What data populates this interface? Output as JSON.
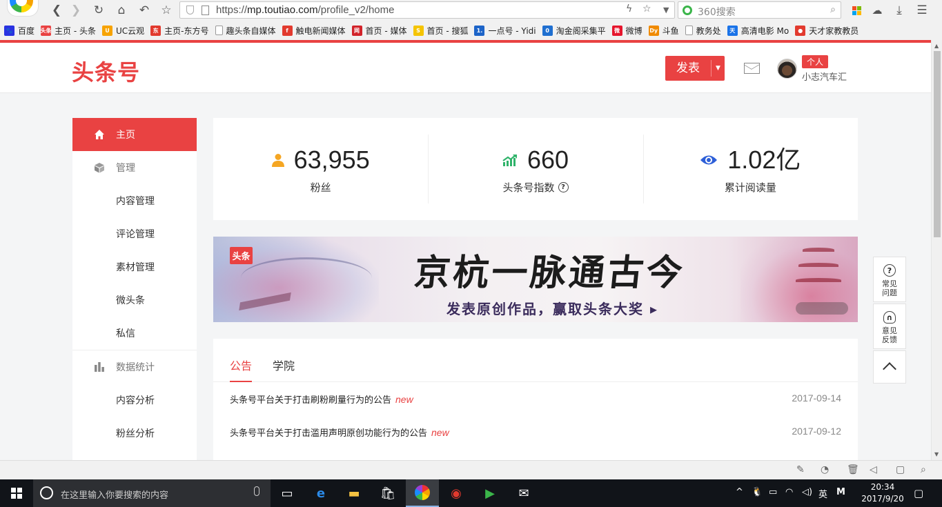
{
  "browser": {
    "url_prefix": "https://",
    "url_host": "mp.toutiao.com",
    "url_path": "/profile_v2/home",
    "search_placeholder": "360搜索",
    "bookmarks": [
      {
        "label": "百度",
        "color": "#2932e1",
        "glyph": "🐾"
      },
      {
        "label": "主页 - 头条",
        "color": "#e94242",
        "glyph": "头条"
      },
      {
        "label": "UC云观",
        "color": "#f7a300",
        "glyph": "U"
      },
      {
        "label": "主页-东方号",
        "color": "#e23a2e",
        "glyph": "东"
      },
      {
        "label": "趣头条自媒体",
        "color": "#ffffff",
        "glyph": ""
      },
      {
        "label": "触电新闻媒体",
        "color": "#e23a2e",
        "glyph": "f"
      },
      {
        "label": "首页 - 媒体",
        "color": "#d2232a",
        "glyph": "网"
      },
      {
        "label": "首页 - 搜狐",
        "color": "#f5c400",
        "glyph": "S"
      },
      {
        "label": "一点号 - Yidi",
        "color": "#1d64c8",
        "glyph": "1."
      },
      {
        "label": "淘金阁采集平",
        "color": "#1f6fd0",
        "glyph": "0"
      },
      {
        "label": "微博",
        "color": "#e6162d",
        "glyph": "微"
      },
      {
        "label": "斗鱼",
        "color": "#f08a00",
        "glyph": "Dy"
      },
      {
        "label": "教务处",
        "color": "#ffffff",
        "glyph": ""
      },
      {
        "label": "高清电影 Mo",
        "color": "#1a73e8",
        "glyph": "天"
      },
      {
        "label": "天才家教教员",
        "color": "#e23a2e",
        "glyph": "●"
      }
    ]
  },
  "header": {
    "logo": "头条号",
    "publish_label": "发表",
    "account_badge": "个人",
    "username": "小志汽车汇"
  },
  "sidebar": {
    "items": [
      {
        "label": "主页",
        "type": "active"
      },
      {
        "label": "管理",
        "type": "section"
      },
      {
        "label": "内容管理",
        "type": "item"
      },
      {
        "label": "评论管理",
        "type": "item"
      },
      {
        "label": "素材管理",
        "type": "item"
      },
      {
        "label": "微头条",
        "type": "item"
      },
      {
        "label": "私信",
        "type": "item"
      },
      {
        "label": "数据统计",
        "type": "section"
      },
      {
        "label": "内容分析",
        "type": "item"
      },
      {
        "label": "粉丝分析",
        "type": "item"
      }
    ]
  },
  "stats": [
    {
      "value": "63,955",
      "label": "粉丝",
      "icon": "user-icon",
      "color": "#f5a623"
    },
    {
      "value": "660",
      "label": "头条号指数",
      "icon": "trend-icon",
      "color": "#2fb36a"
    },
    {
      "value": "1.02亿",
      "label": "累计阅读量",
      "icon": "eye-icon",
      "color": "#2d5fd8"
    }
  ],
  "banner": {
    "badge": "头条",
    "title": "京杭一脉通古今",
    "subtitle": "发表原创作品，赢取头条大奖 ▸"
  },
  "notices": {
    "tabs": [
      "公告",
      "学院"
    ],
    "items": [
      {
        "title": "头条号平台关于打击刷粉刷量行为的公告",
        "tag": "new",
        "date": "2017-09-14"
      },
      {
        "title": "头条号平台关于打击滥用声明原创功能行为的公告",
        "tag": "new",
        "date": "2017-09-12"
      }
    ]
  },
  "float_tools": {
    "faq": "常见问题",
    "feedback": "意见反馈"
  },
  "taskbar": {
    "search_placeholder": "在这里输入你要搜索的内容",
    "ime": "英",
    "time": "20:34",
    "date": "2017/9/20"
  },
  "colors": {
    "brand": "#e94242"
  }
}
